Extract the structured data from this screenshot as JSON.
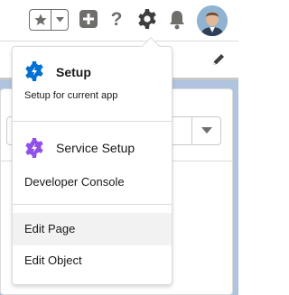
{
  "header": {
    "favorites_icon": "star-icon",
    "favorites_menu_icon": "chevron-down-icon",
    "add_icon": "plus-icon",
    "help_label": "?",
    "setup_icon": "gear-icon",
    "notifications_icon": "bell-icon",
    "avatar": "user-avatar"
  },
  "setup_menu": {
    "setup": {
      "title": "Setup",
      "subtitle": "Setup for current app",
      "icon": "setup-gear-icon",
      "icon_color": "#0070d2"
    },
    "service_setup": {
      "label": "Service Setup",
      "icon": "service-gear-icon",
      "icon_color": "#9050e9"
    },
    "developer_console": {
      "label": "Developer Console"
    },
    "edit_page": {
      "label": "Edit Page"
    },
    "edit_object": {
      "label": "Edit Object"
    }
  },
  "background": {
    "edit_icon": "pencil-icon",
    "select_icon": "chevron-down-icon"
  },
  "colors": {
    "icon_gray": "#706e6b",
    "border": "#dddbda",
    "hover_bg": "#f3f2f2",
    "page_bg": "#b0c4df"
  }
}
